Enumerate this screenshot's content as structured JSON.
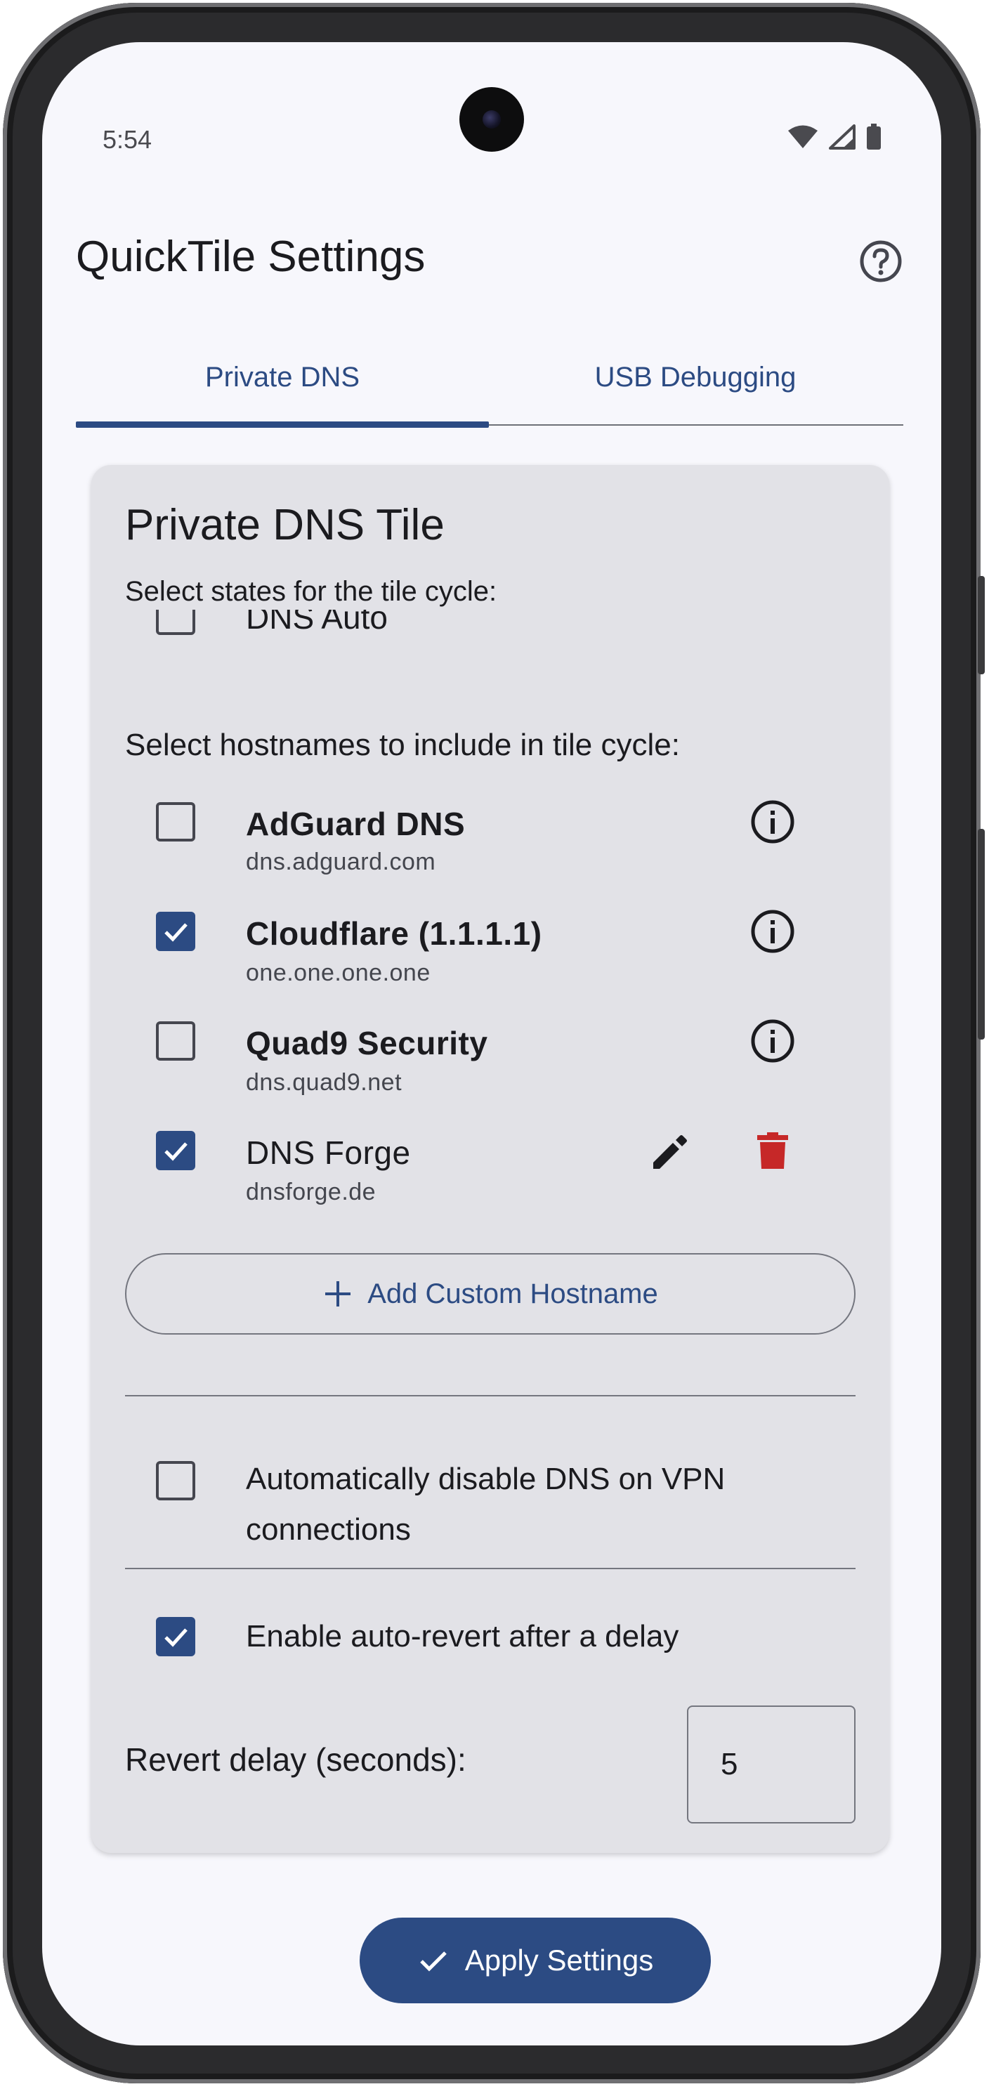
{
  "status_bar": {
    "time": "5:54"
  },
  "app_bar": {
    "title": "QuickTile Settings"
  },
  "tabs": [
    {
      "label": "Private DNS",
      "selected": true
    },
    {
      "label": "USB Debugging",
      "selected": false
    }
  ],
  "card": {
    "title": "Private DNS Tile",
    "states_label": "Select states for the tile cycle:",
    "partial_state": {
      "label": "DNS Auto",
      "checked": false
    },
    "hostnames_label": "Select hostnames to include in tile cycle:",
    "hostnames": [
      {
        "name": "AdGuard DNS",
        "host": "dns.adguard.com",
        "checked": false,
        "custom": false
      },
      {
        "name": "Cloudflare (1.1.1.1)",
        "host": "one.one.one.one",
        "checked": true,
        "custom": false
      },
      {
        "name": "Quad9 Security",
        "host": "dns.quad9.net",
        "checked": false,
        "custom": false
      },
      {
        "name": "DNS Forge",
        "host": "dnsforge.de",
        "checked": true,
        "custom": true
      }
    ],
    "add_custom_label": "Add Custom Hostname",
    "vpn_option": {
      "label": "Automatically disable DNS on VPN connections",
      "checked": false
    },
    "auto_revert": {
      "label": "Enable auto-revert after a delay",
      "checked": true
    },
    "revert_delay": {
      "label": "Revert delay (seconds):",
      "value": "5"
    }
  },
  "apply_label": "Apply Settings",
  "colors": {
    "primary": "#2c4b83",
    "card_bg": "#e2e2e7",
    "screen_bg": "#f7f7fc",
    "delete_red": "#c62828"
  },
  "icons": [
    "help-icon",
    "info-icon",
    "edit-icon",
    "delete-icon",
    "plus-icon",
    "check-icon",
    "wifi-icon",
    "signal-icon",
    "battery-icon"
  ]
}
